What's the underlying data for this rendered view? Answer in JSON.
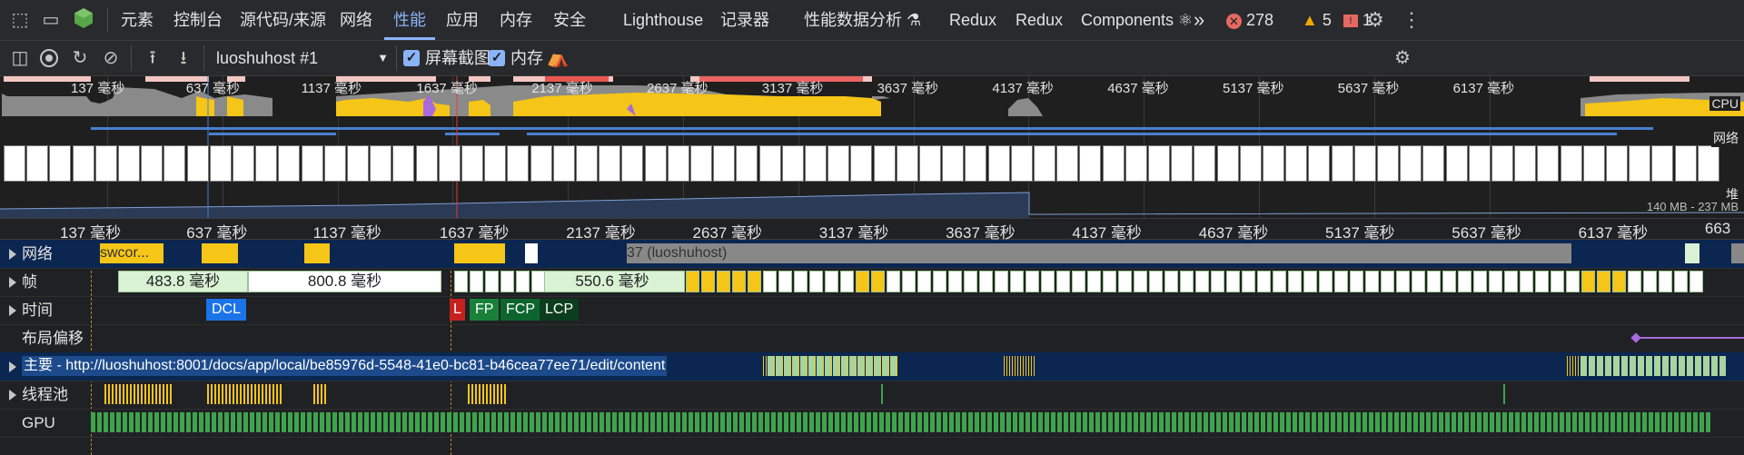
{
  "tabs": {
    "elements": "元素",
    "console": "控制台",
    "sources": "源代码/来源",
    "network": "网络",
    "performance": "性能",
    "application": "应用",
    "memory": "内存",
    "security": "安全",
    "lighthouse": "Lighthouse",
    "recorder": "记录器",
    "perf_insights": "性能数据分析 ⚗",
    "redux1": "Redux",
    "redux2": "Redux",
    "components": "Components ⚛"
  },
  "status": {
    "errors": "278",
    "warnings": "5",
    "issues": "1"
  },
  "toolbar": {
    "profile_select": "luoshuhost #1",
    "screenshots_label": "屏幕截图",
    "memory_label": "内存"
  },
  "overview": {
    "ticks": [
      "137 毫秒",
      "637 毫秒",
      "1137 毫秒",
      "1637 毫秒",
      "2137 毫秒",
      "2637 毫秒",
      "3137 毫秒",
      "3637 毫秒",
      "4137 毫秒",
      "4637 毫秒",
      "5137 毫秒",
      "5637 毫秒",
      "6137 毫秒"
    ],
    "cpu_label": "CPU",
    "net_label": "网络",
    "heap_label": "堆",
    "heap_range": "140 MB - 237 MB"
  },
  "ruler": {
    "ticks": [
      "137 毫秒",
      "637 毫秒",
      "1137 毫秒",
      "1637 毫秒",
      "2137 毫秒",
      "2637 毫秒",
      "3137 毫秒",
      "3637 毫秒",
      "4137 毫秒",
      "4637 毫秒",
      "5137 毫秒",
      "5637 毫秒",
      "6137 毫秒",
      "663"
    ]
  },
  "tracks": {
    "network": "网络",
    "network_item1": "swcor...",
    "network_item2": "37 (luoshuhost)",
    "frames": "帧",
    "frame1": "483.8 毫秒",
    "frame2": "800.8 毫秒",
    "frame3": "550.6 毫秒",
    "timings": "时间",
    "dcl": "DCL",
    "l": "L",
    "fp": "FP",
    "fcp": "FCP",
    "lcp": "LCP",
    "layout_shifts": "布局偏移",
    "main": "主要 - http://luoshuhost:8001/docs/app/local/be85976d-5548-41e0-bc81-b46cea77ee71/edit/content",
    "threadpool": "线程池",
    "gpu": "GPU"
  },
  "colors": {
    "accent": "#8ab4f8",
    "scripting": "#f5c518",
    "rendering": "#a86add",
    "idle": "#d9f2d3"
  }
}
